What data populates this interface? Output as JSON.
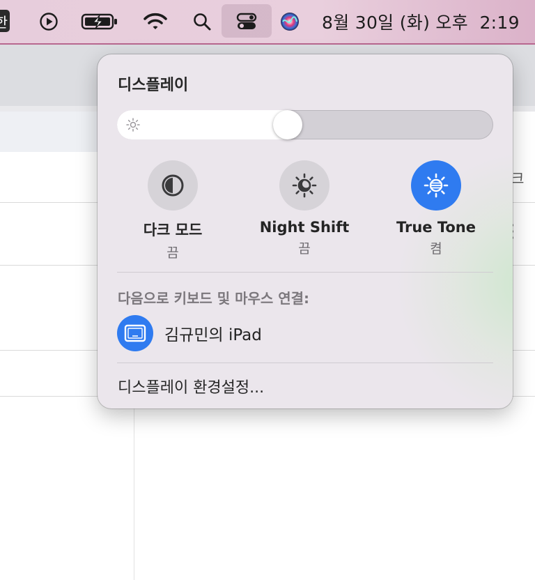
{
  "menubar": {
    "input_source": "한",
    "clock": "8월 30일 (화) 오후  2:19",
    "icons": [
      "input-source-icon",
      "play-icon",
      "battery-charging-icon",
      "wifi-icon",
      "search-icon",
      "control-center-icon",
      "siri-icon"
    ]
  },
  "background_window": {
    "partial_char": "크"
  },
  "control_center": {
    "display": {
      "title": "디스플레이",
      "brightness": 0.45
    },
    "toggles": [
      {
        "label": "다크 모드",
        "state": "끔",
        "active": false,
        "icon": "dark-mode-icon"
      },
      {
        "label": "Night Shift",
        "state": "끔",
        "active": false,
        "icon": "night-shift-icon"
      },
      {
        "label": "True Tone",
        "state": "켬",
        "active": true,
        "icon": "true-tone-icon"
      }
    ],
    "keyboard_mouse": {
      "label": "다음으로 키보드 및 마우스 연결:",
      "device": "김규민의 iPad",
      "device_icon": "ipad-display-icon"
    },
    "preferences_link": "디스플레이 환경설정..."
  },
  "colors": {
    "accent": "#2f7bf0",
    "menubar_bg": "#e7cddc",
    "panel_bg": "#ebe6ec"
  }
}
